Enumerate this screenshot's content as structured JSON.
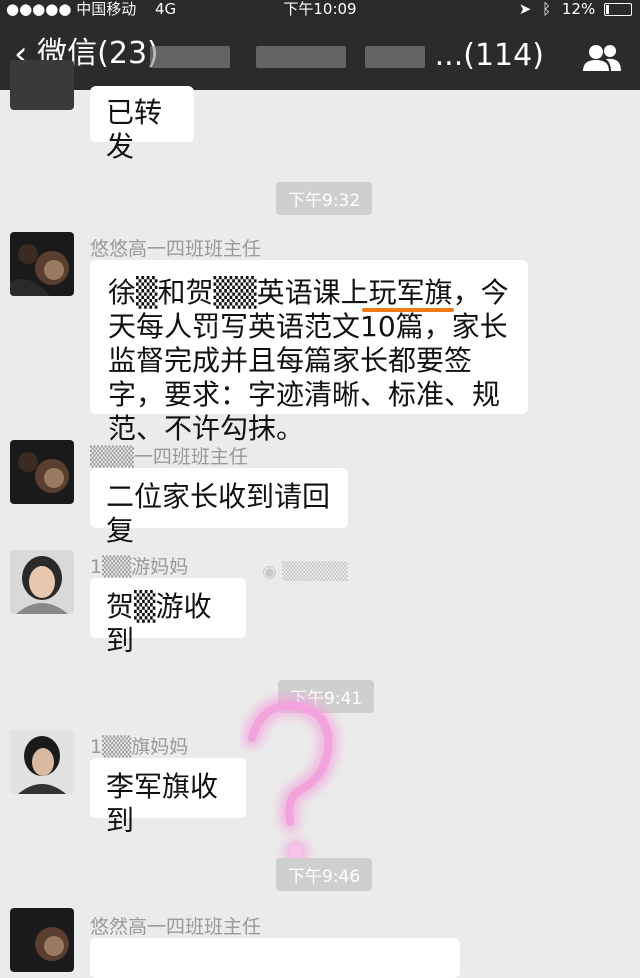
{
  "status": {
    "carrier": "●●●●● 中国移动",
    "network": "4G",
    "time": "下午10:09",
    "battery": "12%",
    "battery_level": 0.12
  },
  "nav": {
    "back_label": "微信(23)",
    "title_suffix": "...(114)",
    "back_icon": "chevron-left-icon",
    "group_icon": "group-icon"
  },
  "messages": [
    {
      "text": "已转发"
    },
    {
      "sender": "悠悠高一四班班主任",
      "text": "徐▒和贺▒▒英语课上玩军旗，今天每人罚写英语范文10篇，家长监督完成并且每篇家长都要签字，要求：字迹清晰、标准、规范、不许勾抹。"
    },
    {
      "sender": "▒▒▒一四班班主任",
      "text": "二位家长收到请回复"
    },
    {
      "sender": "1▒▒游妈妈",
      "text": "贺▒游收到"
    },
    {
      "sender": "1▒▒旗妈妈",
      "text": "李军旗收到"
    },
    {
      "sender": "悠然高一四班班主任",
      "text": ""
    }
  ],
  "times": [
    "下午9:32",
    "下午9:41",
    "下午9:46"
  ],
  "colors": {
    "navbar": "#2b2b2b",
    "background": "#ebebeb",
    "underline": "#f07a1a",
    "question_mark": "#f2a3dc"
  }
}
